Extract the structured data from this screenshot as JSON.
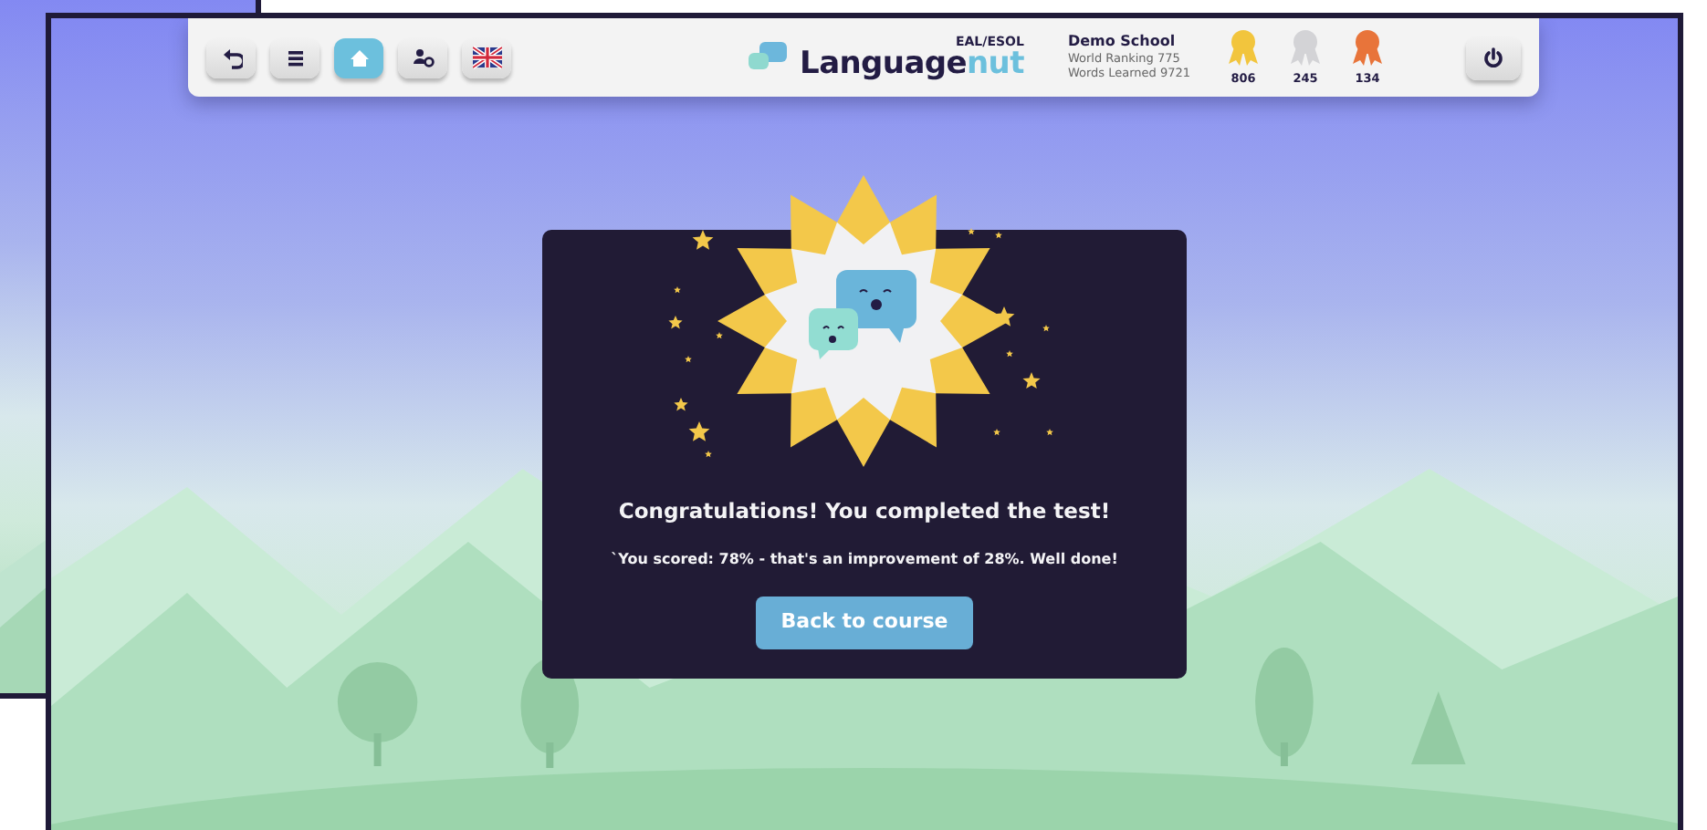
{
  "toolbar": {
    "buttons": [
      {
        "kind": "back",
        "selected": false
      },
      {
        "kind": "menu",
        "selected": false
      },
      {
        "kind": "home",
        "selected": true
      },
      {
        "kind": "profile-settings",
        "selected": false
      },
      {
        "kind": "flag",
        "selected": false
      }
    ]
  },
  "logo": {
    "word": "Language",
    "accent": "nut",
    "tag": "EAL/ESOL"
  },
  "school": {
    "name": "Demo School",
    "ranking": "World Ranking 775",
    "words": "Words Learned 9721"
  },
  "medals": [
    {
      "count": "806",
      "color": "#f2c53d"
    },
    {
      "count": "245",
      "color": "#d3d3d6"
    },
    {
      "count": "134",
      "color": "#e8743a"
    }
  ],
  "dialog": {
    "title": "Congratulations! You completed the test!",
    "message": "`You scored: 78% - that's an improvement of 28%. Well done!",
    "button": "Back to course"
  }
}
